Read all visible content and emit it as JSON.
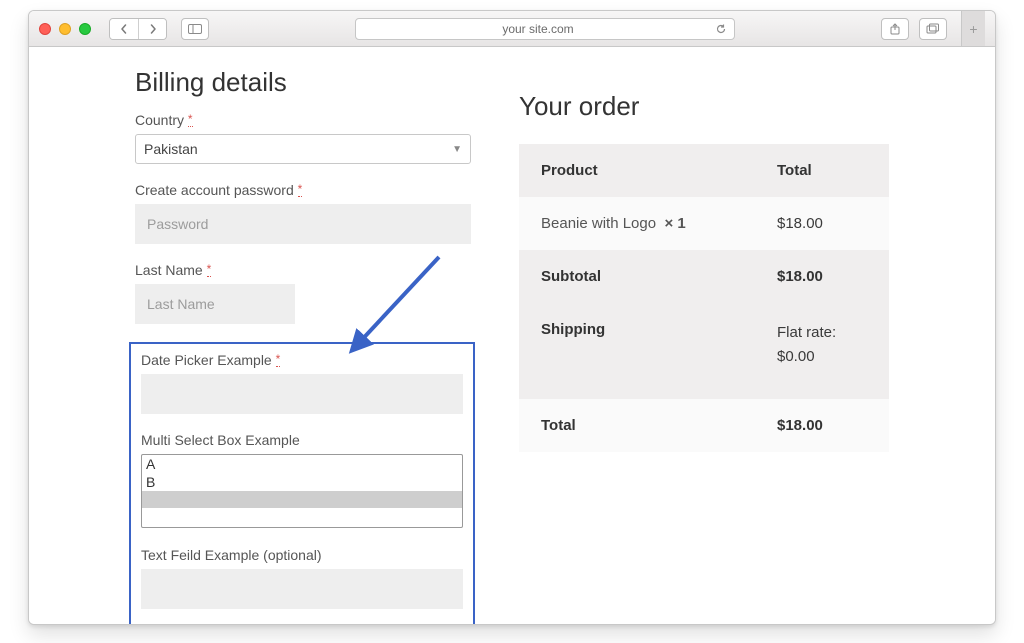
{
  "browser": {
    "url": "your site.com"
  },
  "billing": {
    "title": "Billing details",
    "country_label": "Country",
    "country_value": "Pakistan",
    "password_label": "Create account password",
    "password_placeholder": "Password",
    "lastname_label": "Last Name",
    "lastname_placeholder": "Last Name",
    "date_label": "Date Picker Example",
    "multi_label": "Multi Select Box Example",
    "multi_options": [
      "A",
      "B"
    ],
    "text_label": "Text Feild Example (optional)"
  },
  "order": {
    "title": "Your order",
    "col_product": "Product",
    "col_total": "Total",
    "item_name": "Beanie with Logo",
    "item_qty": "× 1",
    "item_total": "$18.00",
    "subtotal_label": "Subtotal",
    "subtotal_value": "$18.00",
    "shipping_label": "Shipping",
    "shipping_value": "Flat rate: $0.00",
    "total_label": "Total",
    "total_value": "$18.00"
  }
}
